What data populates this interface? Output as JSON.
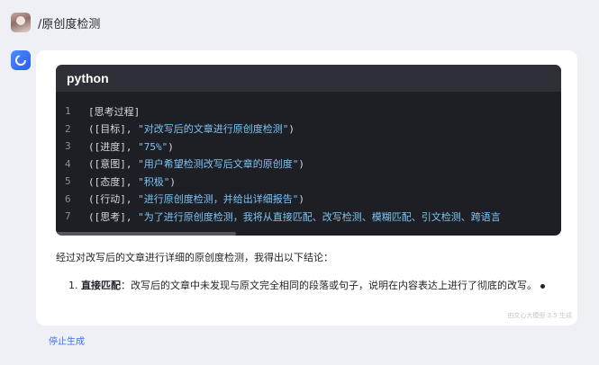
{
  "user": {
    "message": "/原创度检测"
  },
  "icons": {
    "avatar": "user-avatar",
    "bot": "ai-assistant-icon"
  },
  "code_block": {
    "language": "python",
    "lines": [
      {
        "no": "1",
        "plain": "[思考过程]",
        "str": ""
      },
      {
        "no": "2",
        "plain": "([目标], ",
        "str": "\"对改写后的文章进行原创度检测\"",
        "end": ")"
      },
      {
        "no": "3",
        "plain": "([进度], ",
        "str": "\"75%\"",
        "end": ")"
      },
      {
        "no": "4",
        "plain": "([意图], ",
        "str": "\"用户希望检测改写后文章的原创度\"",
        "end": ")"
      },
      {
        "no": "5",
        "plain": "([态度], ",
        "str": "\"积极\"",
        "end": ")"
      },
      {
        "no": "6",
        "plain": "([行动], ",
        "str": "\"进行原创度检测，并给出详细报告\"",
        "end": ")"
      },
      {
        "no": "7",
        "plain": "([思考], ",
        "str": "\"为了进行原创度检测，我将从直接匹配、改写检测、模糊匹配、引文检测、跨语言",
        "end": ""
      }
    ]
  },
  "answer": {
    "summary": "经过对改写后的文章进行详细的原创度检测，我得出以下结论：",
    "items": [
      {
        "number": "1.",
        "title": "直接匹配",
        "text": "：改写后的文章中未发现与原文完全相同的段落或句子，说明在内容表达上进行了彻底的改写。"
      }
    ]
  },
  "watermark": "由文心大模型 3.5 生成",
  "actions": {
    "stop_label": "停止生成"
  },
  "colors": {
    "accent": "#3c6ff0",
    "code_bg": "#1e1f24",
    "code_string": "#7cc4f4"
  }
}
